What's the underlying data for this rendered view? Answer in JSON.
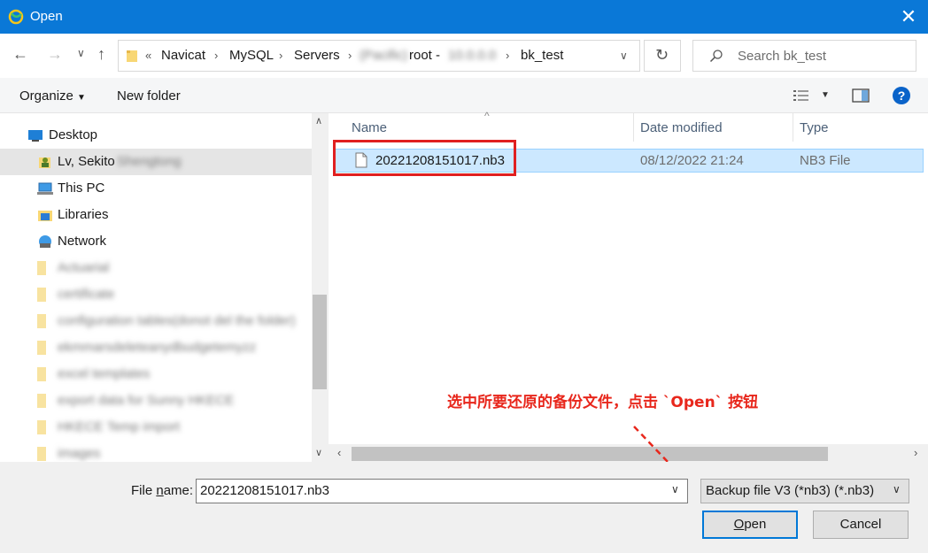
{
  "window": {
    "title": "Open"
  },
  "address": {
    "crumbs": [
      "Navicat",
      "MySQL",
      "Servers"
    ],
    "blurred_server": "(Pacific)",
    "connection_prefix": "root -",
    "blurred_host": "10.0.0.0",
    "current_folder": "bk_test"
  },
  "search": {
    "placeholder": "Search bk_test"
  },
  "toolbar": {
    "organize": "Organize",
    "new_folder": "New folder"
  },
  "tree": {
    "desktop": "Desktop",
    "user": "Lv, Sekito",
    "user_blurred": "Shengtong",
    "this_pc": "This PC",
    "libraries": "Libraries",
    "network": "Network",
    "blurred_folders": [
      "Actuarial",
      "certificate",
      "configuration tables(donot del the folder)",
      "ekmmarsdeleteanydbudgetemyzz",
      "excel templates",
      "export data for Sunny HKECE",
      "HKECE Temp import",
      "images"
    ]
  },
  "columns": {
    "name": "Name",
    "date": "Date modified",
    "type": "Type"
  },
  "files": [
    {
      "name": "20221208151017.nb3",
      "date": "08/12/2022 21:24",
      "type": "NB3 File"
    }
  ],
  "annotation": "选中所要还原的备份文件，点击 `Open` 按钮",
  "bottom": {
    "file_name_label_pre": "File ",
    "file_name_label_u": "n",
    "file_name_label_post": "ame:",
    "file_name_value": "20221208151017.nb3",
    "file_type": "Backup file V3 (*nb3) (*.nb3)",
    "open_u": "O",
    "open_rest": "pen",
    "cancel": "Cancel"
  },
  "colors": {
    "titlebar": "#0a78d7",
    "selection": "#cce8ff",
    "highlight": "#e02020",
    "annotation": "#e8271c"
  }
}
